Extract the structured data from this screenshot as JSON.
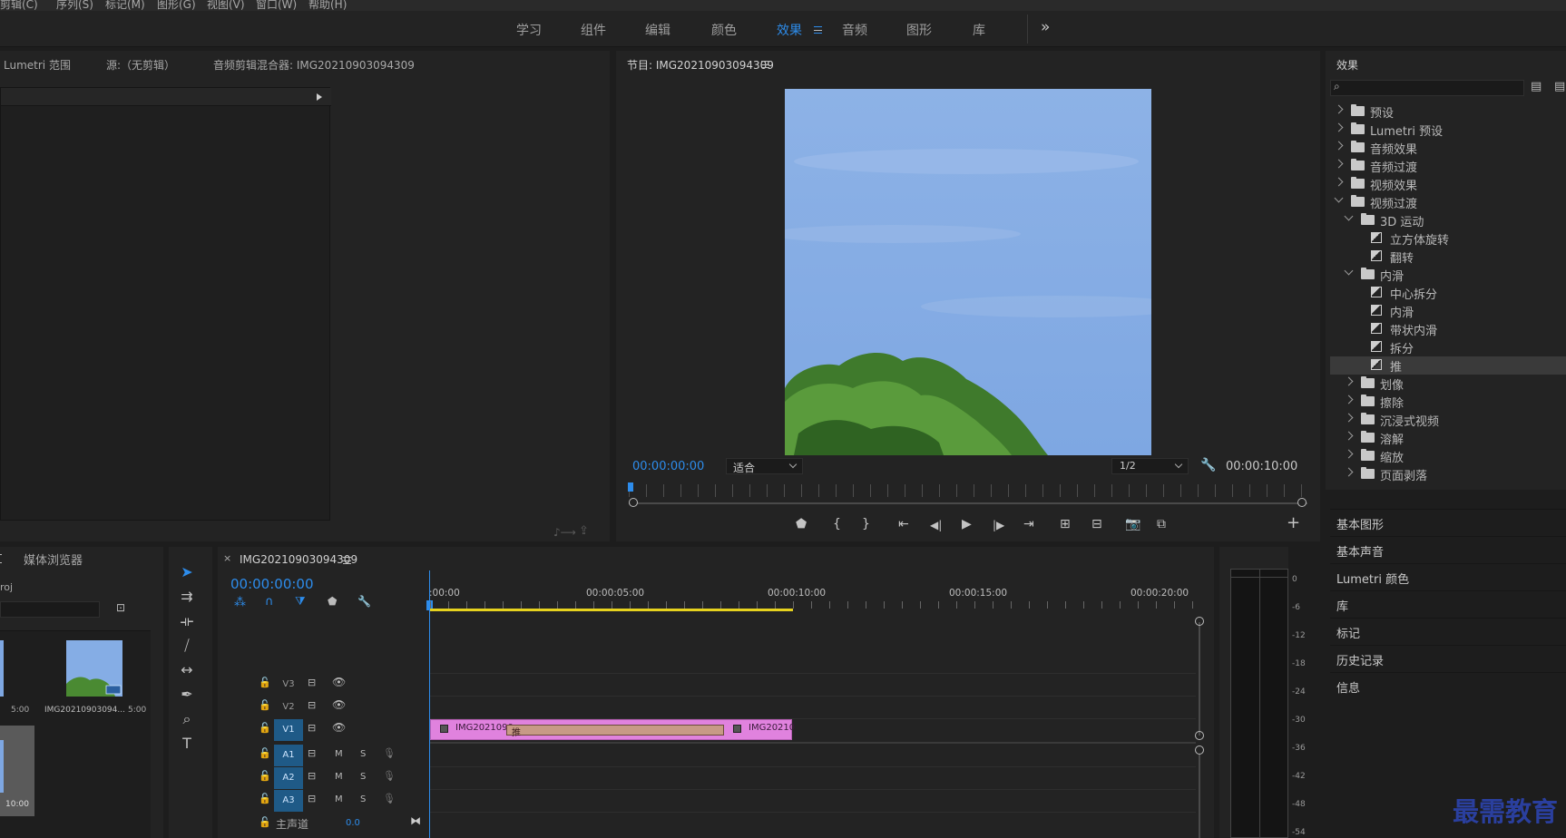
{
  "menu": [
    "剪辑(C)",
    "序列(S)",
    "标记(M)",
    "图形(G)",
    "视图(V)",
    "窗口(W)",
    "帮助(H)"
  ],
  "workspaces": [
    {
      "label": "学习",
      "active": false
    },
    {
      "label": "组件",
      "active": false
    },
    {
      "label": "编辑",
      "active": false
    },
    {
      "label": "颜色",
      "active": false
    },
    {
      "label": "效果",
      "active": true
    },
    {
      "label": "音频",
      "active": false
    },
    {
      "label": "图形",
      "active": false
    },
    {
      "label": "库",
      "active": false
    }
  ],
  "workspace_more": "»",
  "source_panel": {
    "tabs": [
      "Lumetri 范围",
      "源:（无剪辑）",
      "音频剪辑混合器: IMG20210903094309"
    ]
  },
  "program_monitor": {
    "title": "节目: IMG20210903094309",
    "timecode_current": "00:00:00:00",
    "fit": "适合",
    "resolution": "1/2",
    "timecode_duration": "00:00:10:00"
  },
  "effects_panel": {
    "title": "效果",
    "search_placeholder": "",
    "tree": [
      {
        "label": "预设",
        "level": 0,
        "kind": "folder-star",
        "expanded": false
      },
      {
        "label": "Lumetri 预设",
        "level": 0,
        "kind": "folder-star",
        "expanded": false
      },
      {
        "label": "音频效果",
        "level": 0,
        "kind": "folder",
        "expanded": false
      },
      {
        "label": "音频过渡",
        "level": 0,
        "kind": "folder",
        "expanded": false
      },
      {
        "label": "视频效果",
        "level": 0,
        "kind": "folder",
        "expanded": false
      },
      {
        "label": "视频过渡",
        "level": 0,
        "kind": "folder",
        "expanded": true
      },
      {
        "label": "3D 运动",
        "level": 1,
        "kind": "folder",
        "expanded": true
      },
      {
        "label": "立方体旋转",
        "level": 2,
        "kind": "fx"
      },
      {
        "label": "翻转",
        "level": 2,
        "kind": "fx"
      },
      {
        "label": "内滑",
        "level": 1,
        "kind": "folder",
        "expanded": true
      },
      {
        "label": "中心拆分",
        "level": 2,
        "kind": "fx"
      },
      {
        "label": "内滑",
        "level": 2,
        "kind": "fx"
      },
      {
        "label": "带状内滑",
        "level": 2,
        "kind": "fx"
      },
      {
        "label": "拆分",
        "level": 2,
        "kind": "fx"
      },
      {
        "label": "推",
        "level": 2,
        "kind": "fx",
        "selected": true
      },
      {
        "label": "划像",
        "level": 1,
        "kind": "folder",
        "expanded": false
      },
      {
        "label": "擦除",
        "level": 1,
        "kind": "folder",
        "expanded": false
      },
      {
        "label": "沉浸式视频",
        "level": 1,
        "kind": "folder",
        "expanded": false
      },
      {
        "label": "溶解",
        "level": 1,
        "kind": "folder",
        "expanded": false
      },
      {
        "label": "缩放",
        "level": 1,
        "kind": "folder",
        "expanded": false
      },
      {
        "label": "页面剥落",
        "level": 1,
        "kind": "folder",
        "expanded": false
      }
    ],
    "panels": [
      "基本图形",
      "基本声音",
      "Lumetri 颜色",
      "库",
      "标记",
      "历史记录",
      "信息"
    ]
  },
  "project_panel": {
    "tab": "媒体浏览器",
    "path": "roj",
    "items": [
      {
        "name": "",
        "duration": "5:00"
      },
      {
        "name": "IMG20210903094...",
        "duration": "5:00"
      },
      {
        "name": "",
        "duration": "10:00"
      }
    ]
  },
  "timeline": {
    "sequence_name": "IMG20210903094309",
    "timecode": "00:00:00:00",
    "ruler": [
      ":00:00",
      "00:00:05:00",
      "00:00:10:00",
      "00:00:15:00",
      "00:00:20:00"
    ],
    "video_tracks": [
      "V3",
      "V2",
      "V1"
    ],
    "audio_tracks": [
      "A1",
      "A2",
      "A3"
    ],
    "master_label": "主声道",
    "master_value": "0.0",
    "clip_a": "IMG2021090",
    "clip_b": "IMG20210",
    "transition_label": "推",
    "mute_label": "M",
    "solo_label": "S"
  },
  "vu_meter_ticks": [
    "0",
    "-6",
    "-12",
    "-18",
    "-24",
    "-30",
    "-36",
    "-42",
    "-48",
    "-54"
  ],
  "watermark": "最需教育",
  "colors": {
    "accent": "#2d8ceb",
    "clip_pink": "#e082de",
    "transition": "#c79a86",
    "yellow_work_area": "#e6d21e"
  }
}
